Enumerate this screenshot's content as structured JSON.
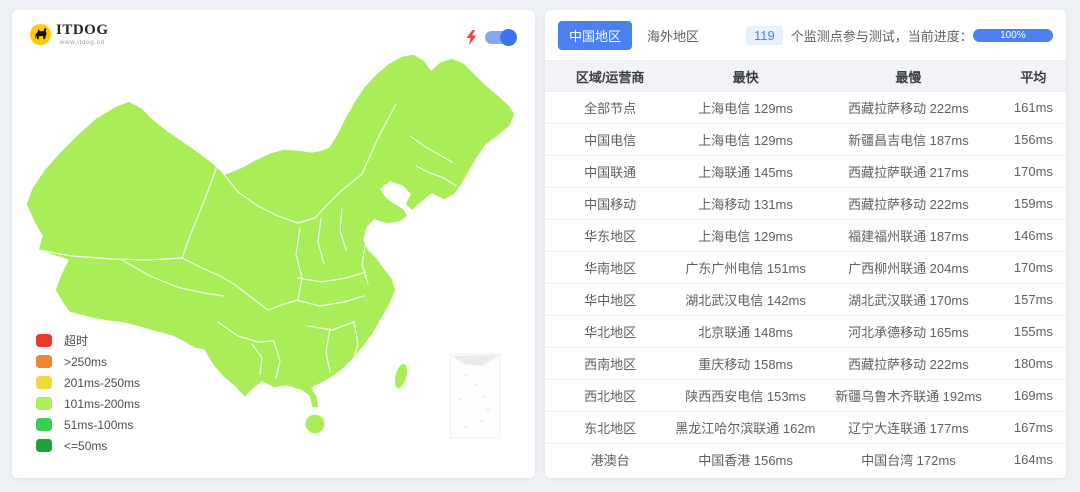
{
  "map_panel": {
    "logo": {
      "brand": "ITDOG",
      "domain": "www.itdog.cn"
    },
    "toggle": {
      "state": "on"
    },
    "legend": [
      {
        "color": "#e93a2b",
        "label": "超时"
      },
      {
        "color": "#f0872e",
        "label": ">250ms"
      },
      {
        "color": "#f0d73e",
        "label": "201ms-250ms"
      },
      {
        "color": "#abef5d",
        "label": "101ms-200ms"
      },
      {
        "color": "#35d14f",
        "label": "51ms-100ms"
      },
      {
        "color": "#1ea23a",
        "label": "<=50ms"
      }
    ],
    "map": {
      "fill": "#a9ed58",
      "border": "#ffffff"
    }
  },
  "results_panel": {
    "tabs": [
      {
        "label": "中国地区",
        "active": true
      },
      {
        "label": "海外地区",
        "active": false
      }
    ],
    "monitor_count": "119",
    "progress_caption": "个监测点参与测试，当前进度：",
    "progress_value": "100%",
    "table": {
      "headers": [
        "区域/运营商",
        "最快",
        "最慢",
        "平均"
      ],
      "rows": [
        [
          "全部节点",
          "上海电信 129ms",
          "西藏拉萨移动 222ms",
          "161ms"
        ],
        [
          "中国电信",
          "上海电信 129ms",
          "新疆昌吉电信 187ms",
          "156ms"
        ],
        [
          "中国联通",
          "上海联通 145ms",
          "西藏拉萨联通 217ms",
          "170ms"
        ],
        [
          "中国移动",
          "上海移动 131ms",
          "西藏拉萨移动 222ms",
          "159ms"
        ],
        [
          "华东地区",
          "上海电信 129ms",
          "福建福州联通 187ms",
          "146ms"
        ],
        [
          "华南地区",
          "广东广州电信 151ms",
          "广西柳州联通 204ms",
          "170ms"
        ],
        [
          "华中地区",
          "湖北武汉电信 142ms",
          "湖北武汉联通 170ms",
          "157ms"
        ],
        [
          "华北地区",
          "北京联通 148ms",
          "河北承德移动 165ms",
          "155ms"
        ],
        [
          "西南地区",
          "重庆移动 158ms",
          "西藏拉萨移动 222ms",
          "180ms"
        ],
        [
          "西北地区",
          "陕西西安电信 153ms",
          "新疆乌鲁木齐联通 192ms",
          "169ms"
        ],
        [
          "东北地区",
          "黑龙江哈尔滨联通 162ms",
          "辽宁大连联通 177ms",
          "167ms"
        ],
        [
          "港澳台",
          "中国香港 156ms",
          "中国台湾 172ms",
          "164ms"
        ]
      ]
    }
  }
}
